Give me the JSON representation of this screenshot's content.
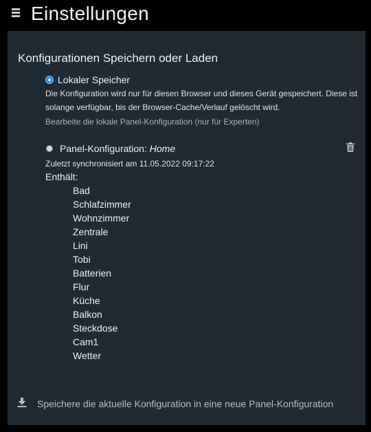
{
  "header": {
    "title": "Einstellungen",
    "menu_icon": "hamburger-menu-icon"
  },
  "section": {
    "title": "Konfigurationen Speichern oder Laden"
  },
  "local_storage": {
    "label": "Lokaler Speicher",
    "selected": true,
    "description": "Die Konfiguration wird nur für diesen Browser und dieses Gerät gespeichert. Diese ist solange verfügbar, bis der Browser-Cache/Verlauf gelöscht wird.",
    "edit_link": "Bearbeite die lokale Panel-Konfiguration (nur für Experten)"
  },
  "panel_config": {
    "label_prefix": "Panel-Konfiguration:",
    "name": "Home",
    "selected": false,
    "last_sync": "Zuletzt synchronisiert am 11.05.2022 09:17:22",
    "contains_label": "Enthält:",
    "rooms": [
      "Bad",
      "Schlafzimmer",
      "Wohnzimmer",
      "Zentrale",
      "Lini",
      "Tobi",
      "Batterien",
      "Flur",
      "Küche",
      "Balkon",
      "Steckdose",
      "Cam1",
      "Wetter"
    ],
    "delete_icon": "trash-icon"
  },
  "save_action": {
    "label": "Speichere die aktuelle Konfiguration in eine neue Panel-Konfiguration",
    "icon": "download-icon"
  },
  "colors": {
    "background": "#000000",
    "panel": "#1f2a33",
    "accent": "#1e8fe8",
    "muted_text": "#a8b2bb"
  }
}
